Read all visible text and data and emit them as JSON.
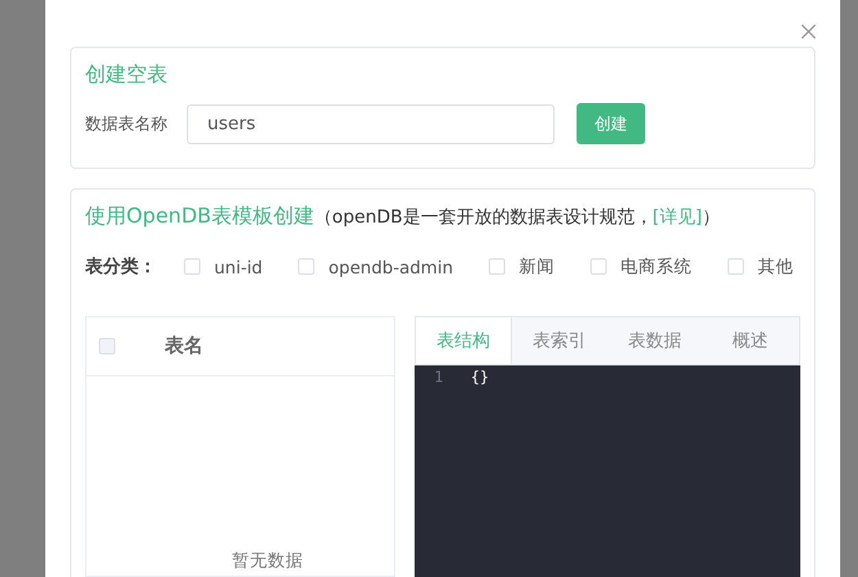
{
  "create_empty": {
    "title": "创建空表",
    "name_label": "数据表名称",
    "name_value": "users",
    "create_button": "创建"
  },
  "template": {
    "title": "使用OpenDB表模板创建",
    "note_prefix": "（openDB是一套开放的数据表设计规范，",
    "link": "[详见]",
    "note_suffix": "）",
    "category_label": "表分类：",
    "categories": [
      {
        "label": "uni-id",
        "checked": false
      },
      {
        "label": "opendb-admin",
        "checked": false
      },
      {
        "label": "新闻",
        "checked": false
      },
      {
        "label": "电商系统",
        "checked": false
      },
      {
        "label": "其他",
        "checked": false
      }
    ],
    "table": {
      "select_all_checked": false,
      "columns": [
        "表名"
      ],
      "empty_text": "暂无数据"
    },
    "tabs": [
      {
        "label": "表结构",
        "selected": true
      },
      {
        "label": "表索引",
        "selected": false
      },
      {
        "label": "表数据",
        "selected": false
      },
      {
        "label": "概述",
        "selected": false
      }
    ],
    "editor": {
      "lines": [
        {
          "number": "1",
          "code": "{}"
        }
      ]
    }
  }
}
